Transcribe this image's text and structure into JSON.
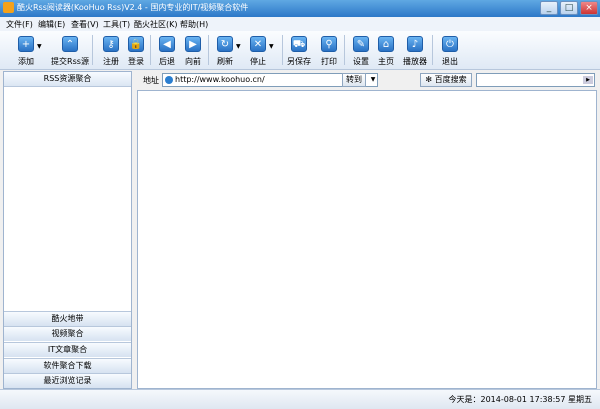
{
  "window": {
    "title": "酷火Rss阅读器(KooHuo Rss)V2.4 - 国内专业的IT/视频聚合软件",
    "min": "_",
    "max": "□",
    "close": "×"
  },
  "menu": [
    "文件(F)",
    "编辑(E)",
    "查看(V)",
    "工具(T)",
    "酷火社区(K)",
    "帮助(H)"
  ],
  "toolbar": [
    {
      "label": "添加",
      "icon": "plus-icon",
      "glyph": "+",
      "drop": true
    },
    {
      "label": "提交Rss源",
      "icon": "double-chevron-up-icon",
      "glyph": "⌃"
    },
    {
      "label": "注册",
      "icon": "key-icon",
      "glyph": "⚷"
    },
    {
      "label": "登录",
      "icon": "lock-icon",
      "glyph": "🔒"
    },
    {
      "label": "后退",
      "icon": "back-arrow-icon",
      "glyph": "◀"
    },
    {
      "label": "向前",
      "icon": "forward-arrow-icon",
      "glyph": "▶"
    },
    {
      "label": "刷新",
      "icon": "refresh-icon",
      "glyph": "↻",
      "drop": true
    },
    {
      "label": "停止",
      "icon": "stop-icon",
      "glyph": "✕",
      "drop": true
    },
    {
      "label": "另保存",
      "icon": "cart-icon",
      "glyph": "⛟"
    },
    {
      "label": "打印",
      "icon": "search-icon",
      "glyph": "⚲"
    },
    {
      "label": "设置",
      "icon": "wrench-icon",
      "glyph": "✎"
    },
    {
      "label": "主页",
      "icon": "home-icon",
      "glyph": "⌂"
    },
    {
      "label": "播放器",
      "icon": "music-note-icon",
      "glyph": "♪"
    },
    {
      "label": "退出",
      "icon": "power-icon",
      "glyph": "⏻"
    }
  ],
  "sidebar": {
    "header": "RSS资源聚合",
    "categories": [
      "酷火地带",
      "视频聚合",
      "IT文章聚合",
      "软件聚合下载",
      "最近浏览记录"
    ]
  },
  "address": {
    "label": "地址",
    "value": "http://www.koohuo.cn/",
    "goto": "转到",
    "search_button": "百度搜索",
    "search_value": ""
  },
  "status": {
    "text": "今天是：2014-08-01 17:38:57   星期五"
  },
  "colors": {
    "titlebar": "#2c78c8",
    "toolbar_icon": "#2a72c4"
  }
}
